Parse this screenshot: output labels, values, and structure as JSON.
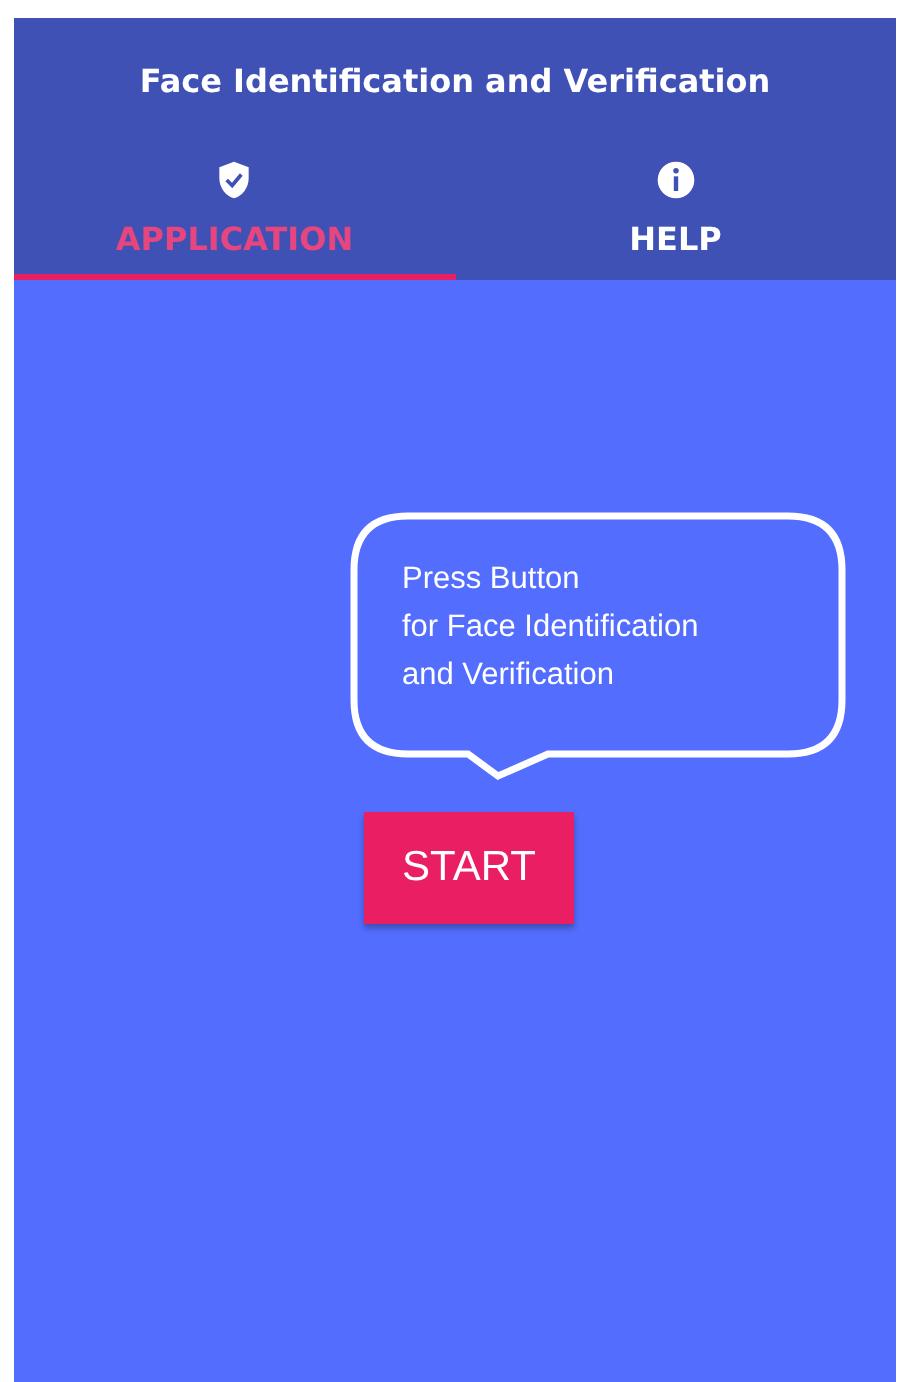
{
  "app_bar": {
    "title": "Face Identification and Verification"
  },
  "tabs": [
    {
      "label": "APPLICATION",
      "kind": "shield",
      "selected": true
    },
    {
      "label": "HELP",
      "kind": "info",
      "selected": false
    }
  ],
  "bubble": {
    "lines": [
      "Press Button",
      "for Face Identification",
      "and Verification"
    ]
  },
  "start_button": {
    "label": "START"
  }
}
